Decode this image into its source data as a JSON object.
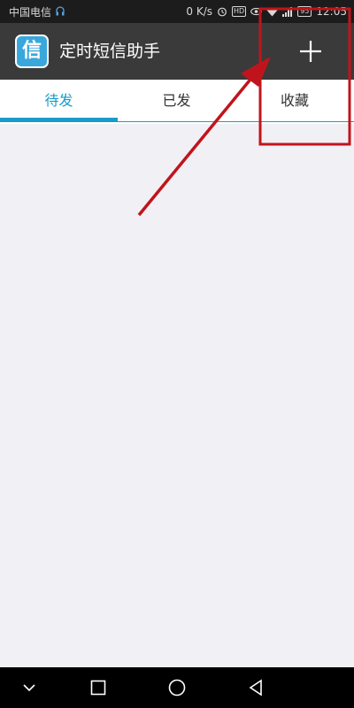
{
  "status_bar": {
    "carrier": "中国电信",
    "speed": "0 K/s",
    "hd": "HD",
    "battery": "95",
    "time": "12:05"
  },
  "app": {
    "title": "定时短信助手",
    "logo_char": "信",
    "add_icon": "plus-icon"
  },
  "tabs": [
    {
      "label": "待发",
      "active": true
    },
    {
      "label": "已发",
      "active": false
    },
    {
      "label": "收藏",
      "active": false
    }
  ],
  "colors": {
    "accent": "#1a9bc8",
    "app_bar": "#3a3a3a",
    "annotation": "#c0141c",
    "background": "#f1f0f5"
  },
  "nav": {
    "items": [
      "chevron-down-icon",
      "square-icon",
      "circle-icon",
      "triangle-back-icon"
    ]
  }
}
